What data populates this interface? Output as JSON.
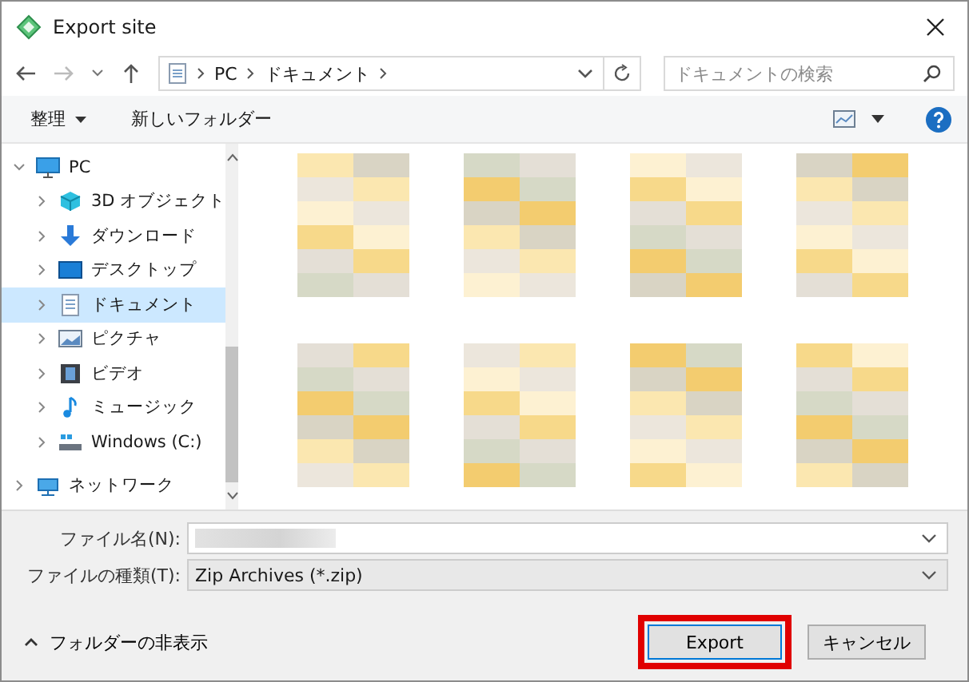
{
  "window": {
    "title": "Export site"
  },
  "nav": {
    "path": [
      "PC",
      "ドキュメント"
    ],
    "search": {
      "placeholder": "ドキュメントの検索"
    }
  },
  "toolbar": {
    "organize": "整理",
    "new_folder": "新しいフォルダー"
  },
  "sidebar": {
    "items": [
      {
        "label": "PC",
        "kind": "pc",
        "expanded": true,
        "selected": false,
        "children": [
          {
            "label": "3D オブジェクト",
            "kind": "cube",
            "expanded": false,
            "selected": false
          },
          {
            "label": "ダウンロード",
            "kind": "download",
            "expanded": false,
            "selected": false
          },
          {
            "label": "デスクトップ",
            "kind": "desktop",
            "expanded": false,
            "selected": false
          },
          {
            "label": "ドキュメント",
            "kind": "document",
            "expanded": false,
            "selected": true
          },
          {
            "label": "ピクチャ",
            "kind": "pictures",
            "expanded": false,
            "selected": false
          },
          {
            "label": "ビデオ",
            "kind": "video",
            "expanded": false,
            "selected": false
          },
          {
            "label": "ミュージック",
            "kind": "music",
            "expanded": false,
            "selected": false
          },
          {
            "label": "Windows (C:)",
            "kind": "drive",
            "expanded": false,
            "selected": false
          }
        ]
      },
      {
        "label": "ネットワーク",
        "kind": "network",
        "expanded": false,
        "selected": false
      }
    ]
  },
  "form": {
    "filename_label": "ファイル名(N):",
    "filetype_label": "ファイルの種類(T):",
    "filetype_value": "Zip Archives (*.zip)"
  },
  "footer": {
    "hide_folders": "フォルダーの非表示",
    "buttons": [
      {
        "label": "Export",
        "highlighted": true
      },
      {
        "label": "キャンセル",
        "highlighted": false
      }
    ]
  }
}
